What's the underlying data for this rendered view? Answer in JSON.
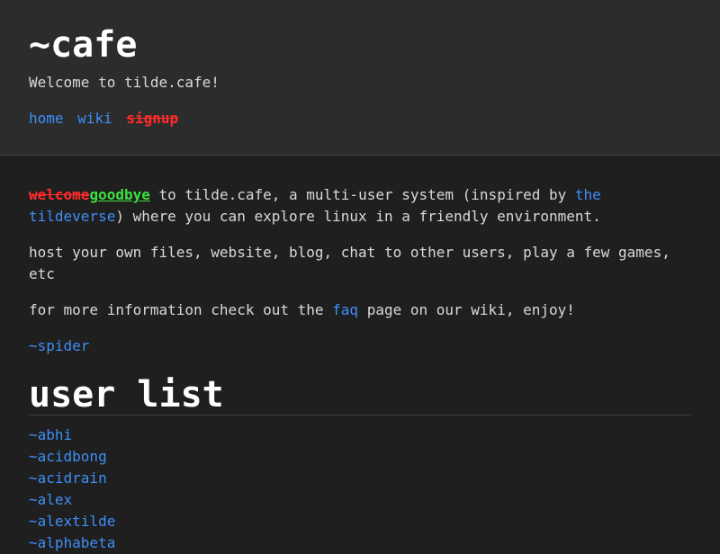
{
  "header": {
    "title": "~cafe",
    "tagline": "Welcome to tilde.cafe!",
    "nav": [
      {
        "label": "home",
        "style": "link"
      },
      {
        "label": "wiki",
        "style": "link"
      },
      {
        "label": "signup",
        "style": "strike"
      }
    ]
  },
  "intro": {
    "word_deleted": "welcome",
    "word_inserted": "goodbye",
    "p1_text_a": " to tilde.cafe, a multi-user system (inspired by ",
    "p1_link": "the tildeverse",
    "p1_text_b": ") where you can explore linux in a friendly environment.",
    "p2": "host your own files, website, blog, chat to other users, play a few games, etc",
    "p3_text_a": "for more information check out the ",
    "p3_link": "faq",
    "p3_text_b": " page on our wiki, enjoy!",
    "signature": "~spider"
  },
  "userlist": {
    "title": "user list",
    "users": [
      "~abhi",
      "~acidbong",
      "~acidrain",
      "~alex",
      "~alextilde",
      "~alphabeta"
    ]
  },
  "colors": {
    "link": "#3f8ef7",
    "strike_red": "#ff2b2b",
    "insert_green": "#3ee03e",
    "header_bg": "#2c2c2c",
    "body_bg": "#1f1f1f"
  }
}
